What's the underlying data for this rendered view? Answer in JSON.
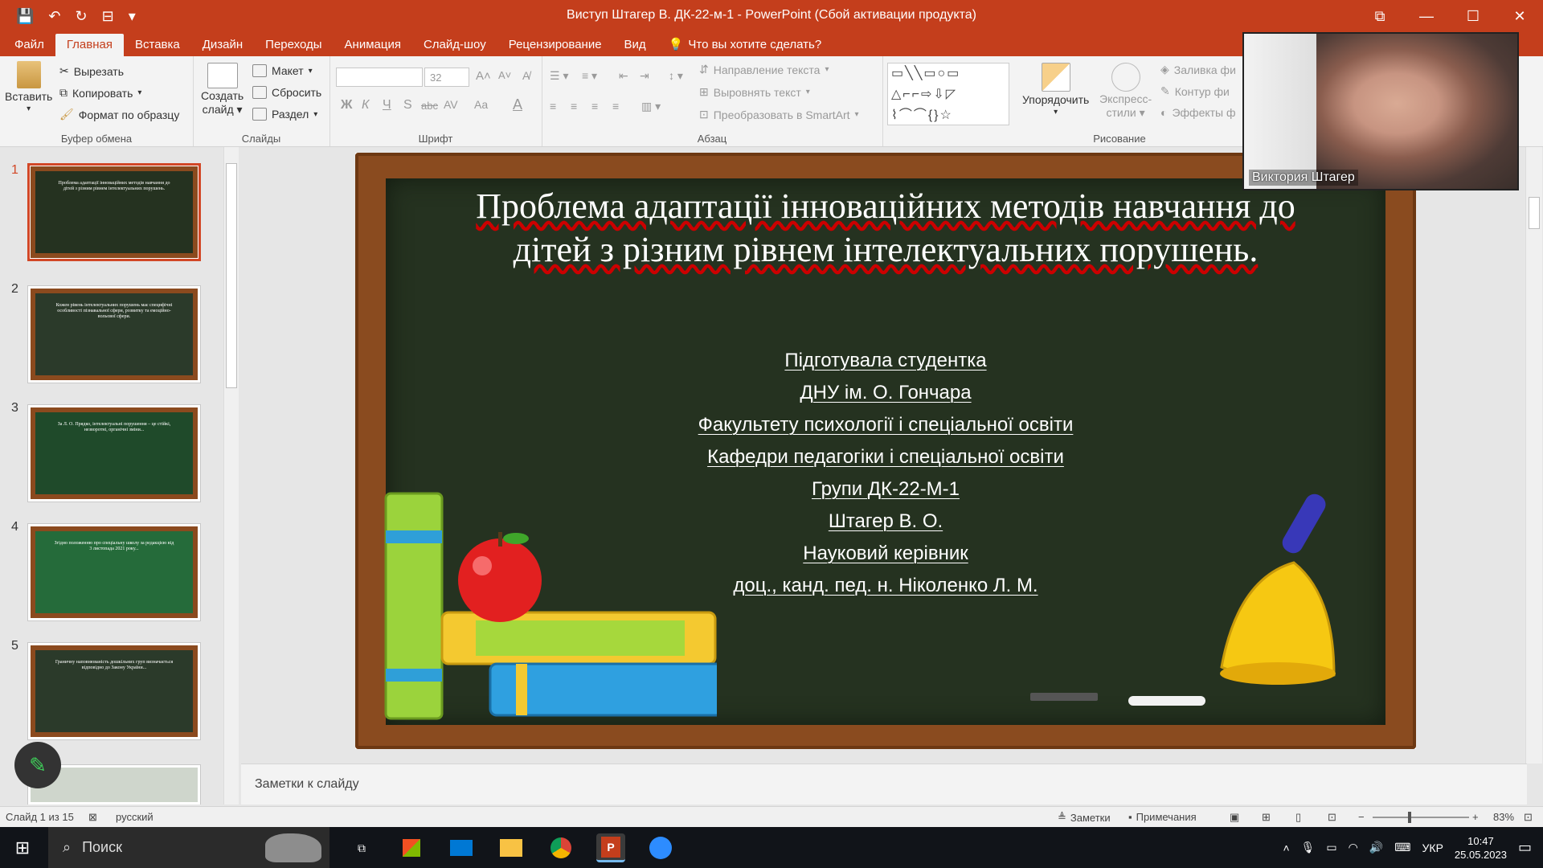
{
  "window": {
    "title": "Виступ Штагер В. ДК-22-м-1 - PowerPoint (Сбой активации продукта)",
    "quick_access": [
      "save-icon",
      "undo-icon",
      "redo-icon",
      "present-icon",
      "customize-icon"
    ]
  },
  "tabs": [
    {
      "label": "Файл"
    },
    {
      "label": "Главная",
      "active": true
    },
    {
      "label": "Вставка"
    },
    {
      "label": "Дизайн"
    },
    {
      "label": "Переходы"
    },
    {
      "label": "Анимация"
    },
    {
      "label": "Слайд-шоу"
    },
    {
      "label": "Рецензирование"
    },
    {
      "label": "Вид"
    }
  ],
  "tell_me": "Что вы хотите сделать?",
  "ribbon": {
    "clipboard": {
      "paste": "Вставить",
      "cut": "Вырезать",
      "copy": "Копировать",
      "format_painter": "Формат по образцу",
      "label": "Буфер обмена"
    },
    "slides": {
      "new_slide_l1": "Создать",
      "new_slide_l2": "слайд",
      "layout": "Макет",
      "reset": "Сбросить",
      "section": "Раздел",
      "label": "Слайды"
    },
    "font": {
      "size": "32",
      "label": "Шрифт",
      "bold": "Ж",
      "italic": "К",
      "underline": "Ч",
      "strike": "S",
      "abc": "abc",
      "av": "AV",
      "aa": "Aa",
      "fontcolor": "A"
    },
    "paragraph": {
      "text_direction": "Направление текста",
      "align_text": "Выровнять текст",
      "smartart": "Преобразовать в SmartArt",
      "label": "Абзац"
    },
    "drawing": {
      "arrange": "Упорядочить",
      "quick_styles_l1": "Экспресс-",
      "quick_styles_l2": "стили",
      "fill": "Заливка фи",
      "outline": "Контур фи",
      "effects": "Эффекты ф",
      "label": "Рисование"
    }
  },
  "thumbnails": [
    {
      "num": "1",
      "selected": true,
      "color": "#253220",
      "text": "Проблема адаптації інноваційних методів навчання до дітей з різним рівнем інтелектуальних порушень."
    },
    {
      "num": "2",
      "color": "#2b3a2a",
      "text": "Кожен рівень інтелектуальних порушень має специфічні особливості пізнавальної сфери, розвитку та емоційно-вольової сфери."
    },
    {
      "num": "3",
      "color": "#1f4a2a",
      "text": "За Л. О. Прядко, інтелектуальні порушення – це стійкі, незворотні, органічні зміни..."
    },
    {
      "num": "4",
      "color": "#256b3a",
      "text": "Згідно положенню про спеціальну школу за редакцією від 3 листопада 2021 року..."
    },
    {
      "num": "5",
      "color": "#2b3a2a",
      "text": "Граничну наповнюваність дошкільних груп визначається відповідно до Закону України..."
    }
  ],
  "slide": {
    "title": "Проблема адаптації інноваційних методів навчання до дітей з різним рівнем інтелектуальних порушень.",
    "lines": [
      "Підготувала студентка",
      "ДНУ ім. О. Гончара",
      "Факультету психології і спеціальної освіти",
      "Кафедри педагогіки і спеціальної освіти",
      "Групи ДК-22-М-1",
      "Штагер В. О.",
      "Науковий керівник",
      "доц., канд. пед. н. Ніколенко Л. М."
    ]
  },
  "notes_placeholder": "Заметки к слайду",
  "status": {
    "slide_count": "Слайд 1 из 15",
    "language": "русский",
    "notes": "Заметки",
    "comments": "Примечания",
    "zoom": "83%"
  },
  "taskbar": {
    "search": "Поиск",
    "lang": "УКР",
    "time": "10:47",
    "date": "25.05.2023"
  },
  "zoom_video": {
    "name": "Виктория Штагер"
  },
  "colors": {
    "accent": "#c43e1c",
    "chalkboard": "#253220",
    "frame": "#8a4b1f"
  }
}
